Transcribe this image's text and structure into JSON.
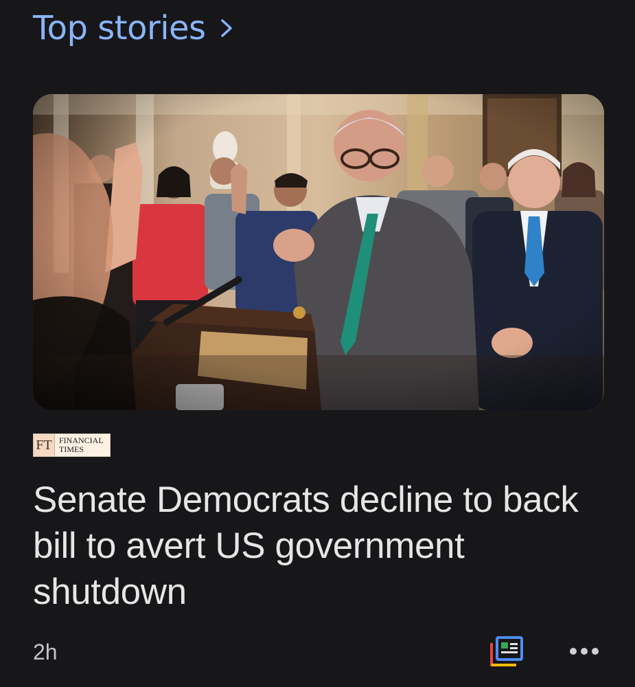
{
  "section": {
    "title": "Top stories",
    "chevron_icon": "chevron-right-icon"
  },
  "story": {
    "image_icon": "press-conference-photo",
    "source": {
      "logo_mark": "FT",
      "name": "FINANCIAL\nTIMES"
    },
    "headline": "Senate Democrats decline to back bill to avert US government shutdown",
    "timestamp": "2h",
    "actions": {
      "full_coverage_icon": "full-coverage-icon",
      "more_icon": "more-horizontal-icon"
    }
  },
  "colors": {
    "background": "#17171a",
    "accent": "#8ab4f8",
    "headline": "#e6e6e6",
    "meta": "#c4c4c8"
  }
}
